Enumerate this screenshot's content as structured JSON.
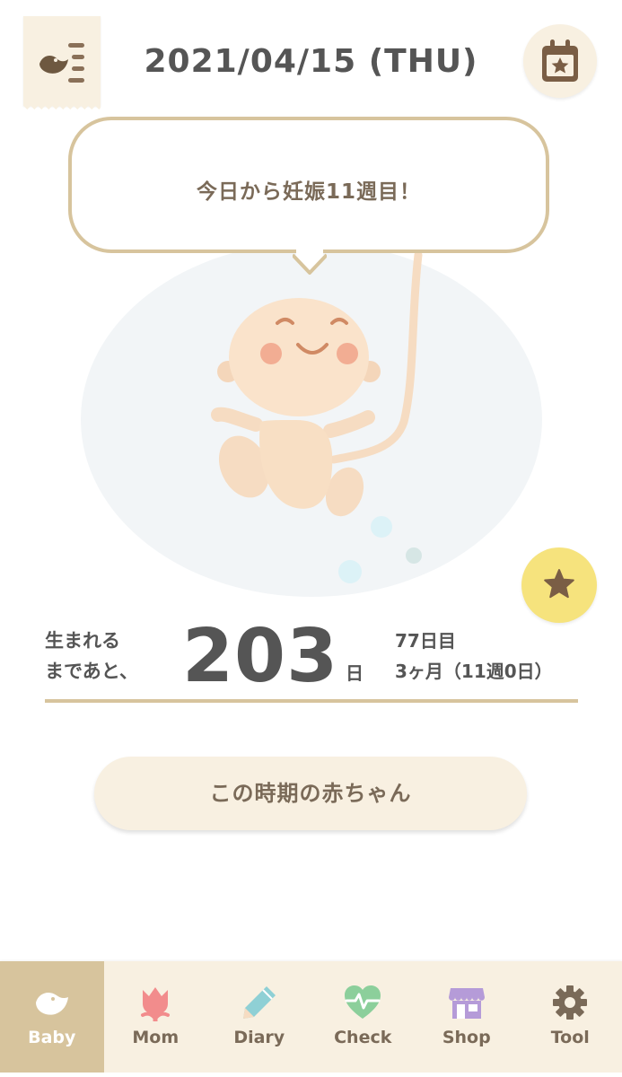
{
  "header": {
    "date": "2021/04/15 (THU)",
    "menu_icon": "bird-list-icon",
    "calendar_icon": "calendar-star-icon"
  },
  "bubble": {
    "message": "今日から妊娠11週目！"
  },
  "countdown": {
    "label_line1": "生まれる",
    "label_line2": "まであと、",
    "days": "203",
    "unit": "日",
    "day_count": "77日目",
    "month_week": "3ヶ月（11週0日）"
  },
  "actions": {
    "favorite_icon": "star-icon",
    "cta_label": "この時期の赤ちゃん"
  },
  "tabs": [
    {
      "label": "Baby",
      "icon": "baby-bird-icon",
      "active": true
    },
    {
      "label": "Mom",
      "icon": "tulip-icon",
      "active": false
    },
    {
      "label": "Diary",
      "icon": "pencil-icon",
      "active": false
    },
    {
      "label": "Check",
      "icon": "heart-pulse-icon",
      "active": false
    },
    {
      "label": "Shop",
      "icon": "shop-icon",
      "active": false
    },
    {
      "label": "Tool",
      "icon": "gear-icon",
      "active": false
    }
  ],
  "colors": {
    "accent_beige": "#d7c49d",
    "panel_cream": "#f8f0e1",
    "favorite_yellow": "#f6e37d",
    "text_dark": "#555555",
    "text_brown": "#7a6a58",
    "mom_pink": "#f28c8c",
    "diary_teal": "#8fd0d5",
    "check_green": "#8ccf9b",
    "shop_purple": "#b59bd8",
    "tool_brown": "#7a6a58"
  }
}
